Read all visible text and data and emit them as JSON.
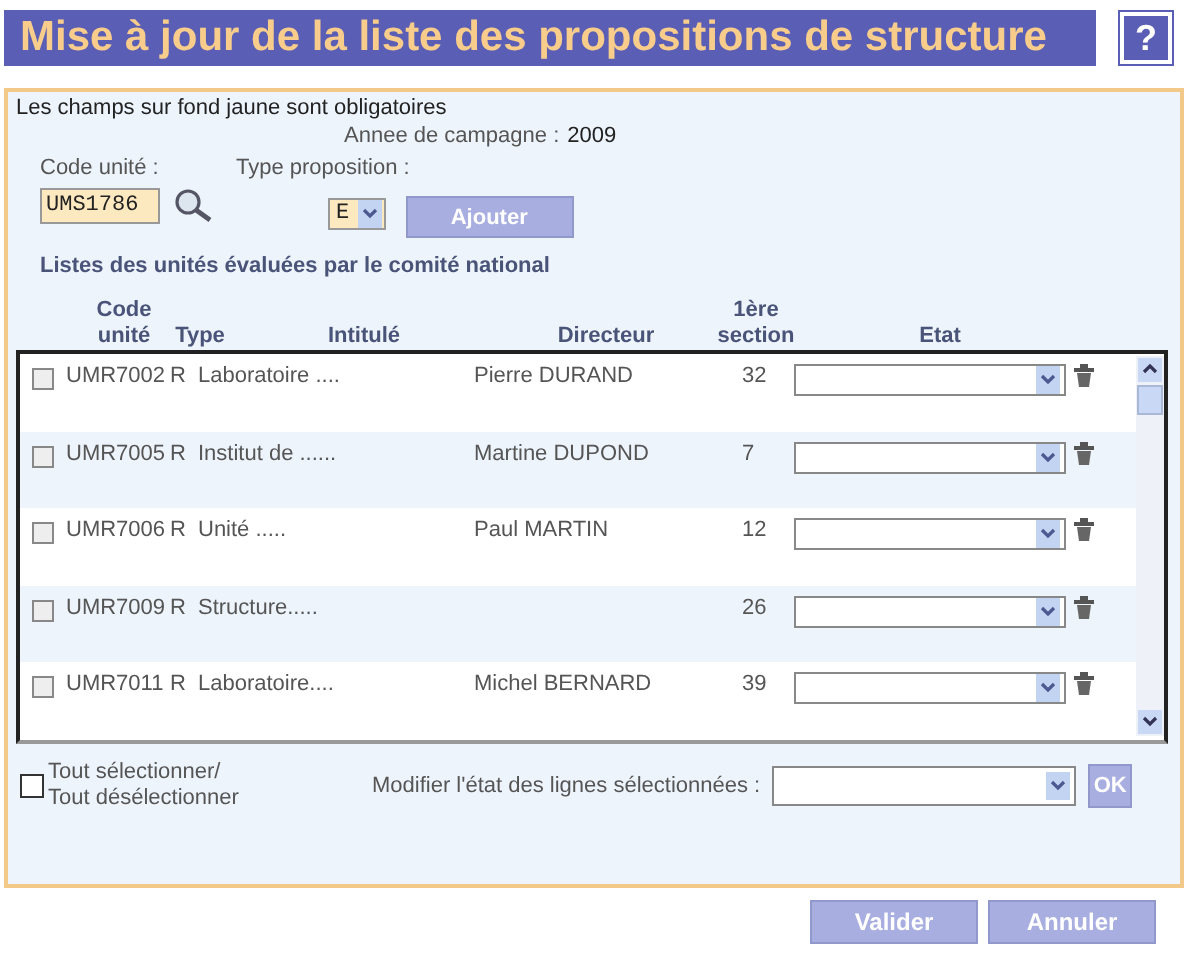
{
  "title": "Mise à jour de la liste des propositions de structure",
  "help": "?",
  "notice": "Les champs sur fond jaune sont obligatoires",
  "campaign": {
    "label": "Annee de campagne :",
    "value": "2009"
  },
  "code_field": {
    "label": "Code unité :",
    "value": "UMS1786"
  },
  "type_field": {
    "label": "Type proposition :",
    "value": "E"
  },
  "add_button": "Ajouter",
  "section_title": "Listes des unités évaluées par le comité national",
  "table": {
    "columns": [
      "Code unité",
      "Type",
      "Intitulé",
      "Directeur",
      "1ère section",
      "Etat"
    ],
    "rows": [
      {
        "checked": false,
        "code": "UMR7002",
        "type": "R",
        "title": "Laboratoire ....",
        "director": "Pierre DURAND",
        "section": "32"
      },
      {
        "checked": false,
        "code": "UMR7005",
        "type": "R",
        "title": "Institut de ......",
        "director": "Martine DUPOND",
        "section": "7"
      },
      {
        "checked": false,
        "code": "UMR7006",
        "type": "R",
        "title": "Unité .....",
        "director": "Paul MARTIN",
        "section": "12"
      },
      {
        "checked": false,
        "code": "UMR7009",
        "type": "R",
        "title": "Structure.....",
        "director": "",
        "section": "26"
      },
      {
        "checked": false,
        "code": "UMR7011",
        "type": "R",
        "title": "Laboratoire....",
        "director": "Michel BERNARD",
        "section": "39"
      }
    ]
  },
  "select_all": {
    "label": "Tout sélectionner/\nTout désélectionner",
    "checked": false
  },
  "bulk": {
    "label": "Modifier l'état des lignes sélectionnées :",
    "button": "OK"
  },
  "buttons": [
    "Valider",
    "Annuler"
  ]
}
